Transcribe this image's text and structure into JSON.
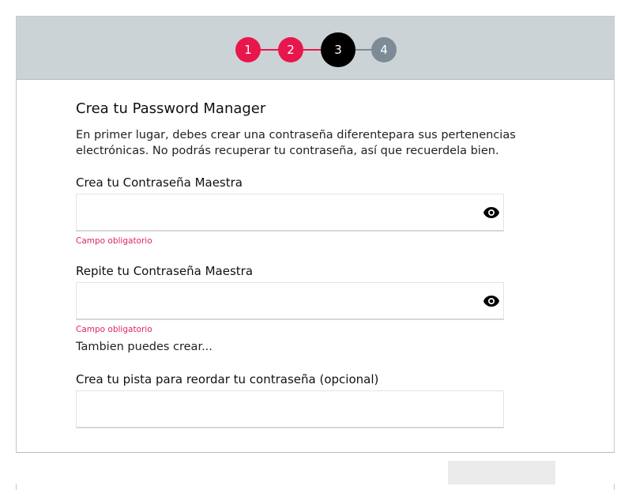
{
  "stepper": {
    "steps": [
      {
        "label": "1",
        "state": "done"
      },
      {
        "label": "2",
        "state": "done"
      },
      {
        "label": "3",
        "state": "current"
      },
      {
        "label": "4",
        "state": "pending"
      }
    ],
    "colors": {
      "done": "#e8174b",
      "current": "#000000",
      "pending": "#7d8b96",
      "bar": "#ccd3d7"
    }
  },
  "form": {
    "title": "Crea tu Password Manager",
    "intro": "En primer lugar, debes crear una contraseña diferentepara sus pertenencias electrónicas. No podrás recuperar tu contraseña, así que recuerdela bien.",
    "password": {
      "label": "Crea tu Contraseña Maestra",
      "value": "",
      "error": "Campo obligatorio",
      "icon": "eye-icon"
    },
    "repeat": {
      "label": "Repite tu Contraseña Maestra",
      "value": "",
      "error": "Campo obligatorio",
      "icon": "eye-icon"
    },
    "also_text": "Tambien puedes crear...",
    "hint": {
      "label": "Crea tu pista para reordar tu contraseña (opcional)",
      "value": ""
    }
  },
  "colors": {
    "error": "#e0245e"
  }
}
